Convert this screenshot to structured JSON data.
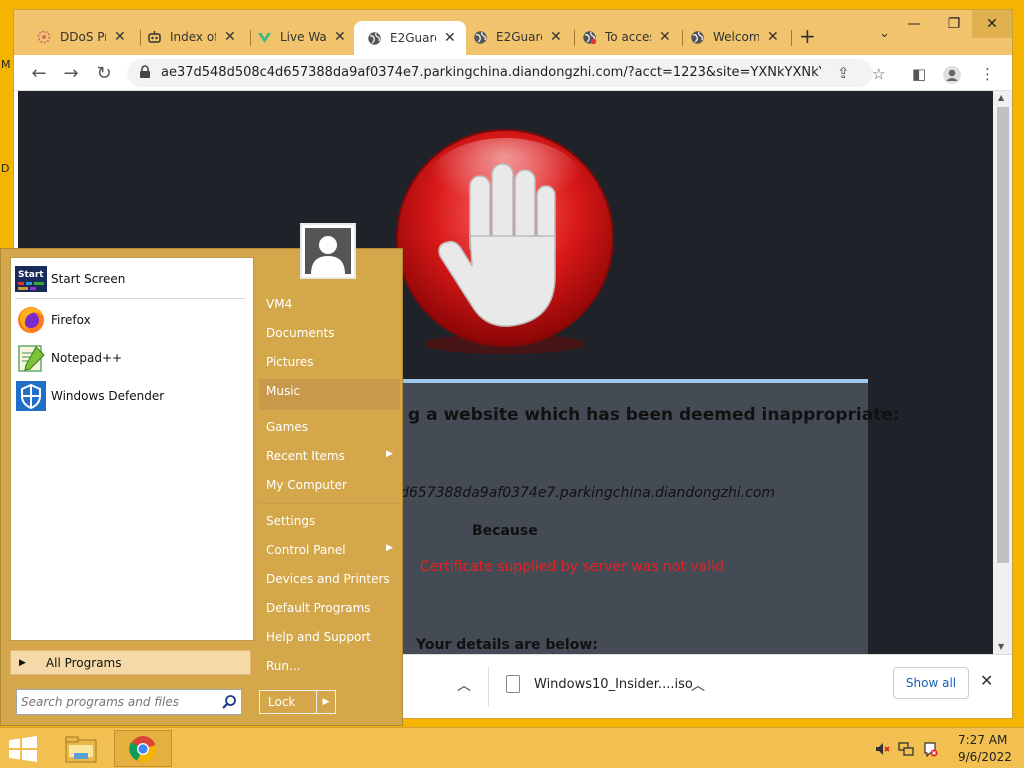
{
  "desktop": {
    "edge_text_1": "M",
    "edge_text_2": "D"
  },
  "browser": {
    "tabs": [
      {
        "title": "DDoS Pr",
        "icon": "ddos-favicon"
      },
      {
        "title": "Index of",
        "icon": "index-favicon"
      },
      {
        "title": "Live Wal",
        "icon": "live-favicon"
      },
      {
        "title": "E2Guard",
        "icon": "globe-icon",
        "active": true
      },
      {
        "title": "E2Guard",
        "icon": "globe-icon"
      },
      {
        "title": "To acces",
        "icon": "globe-icon"
      },
      {
        "title": "Welcom",
        "icon": "globe-icon"
      }
    ],
    "new_tab": "+",
    "url": "ae37d548d508c4d657388da9af0374e7.parkingchina.diandongzhi.com/?acct=1223&site=YXNkYXNkYWQu..."
  },
  "page": {
    "title": "g a website which has been deemed inappropriate:",
    "blocked_url": "d657388da9af0374e7.parkingchina.diandongzhi.com",
    "because": "Because",
    "reason": "Certificate supplied by server was not valid",
    "details": "Your details are below:"
  },
  "downloads": {
    "file_name": "Windows10_Insider....iso",
    "show_all": "Show all"
  },
  "start_menu": {
    "programs": [
      {
        "label": "Start Screen",
        "icon": "start-screen-icon"
      },
      {
        "label": "Firefox",
        "icon": "firefox-icon"
      },
      {
        "label": "Notepad++",
        "icon": "notepad-icon"
      },
      {
        "label": "Windows Defender",
        "icon": "defender-icon"
      }
    ],
    "start_screen_badge": "Start",
    "all_programs": "All Programs",
    "search_placeholder": "Search programs and files",
    "right_items": {
      "user": "VM4",
      "documents": "Documents",
      "pictures": "Pictures",
      "music": "Music",
      "games": "Games",
      "recent": "Recent Items",
      "computer": "My Computer",
      "settings": "Settings",
      "control_panel": "Control Panel",
      "devices": "Devices and Printers",
      "default_programs": "Default Programs",
      "help": "Help and Support",
      "run": "Run..."
    },
    "lock": "Lock"
  },
  "taskbar": {
    "time": "7:27 AM",
    "date": "9/6/2022"
  },
  "colors": {
    "accent": "#f4b400",
    "start_menu_bg": "#d4a84a",
    "page_bg": "#1f2329",
    "reason_red": "#e82020"
  }
}
